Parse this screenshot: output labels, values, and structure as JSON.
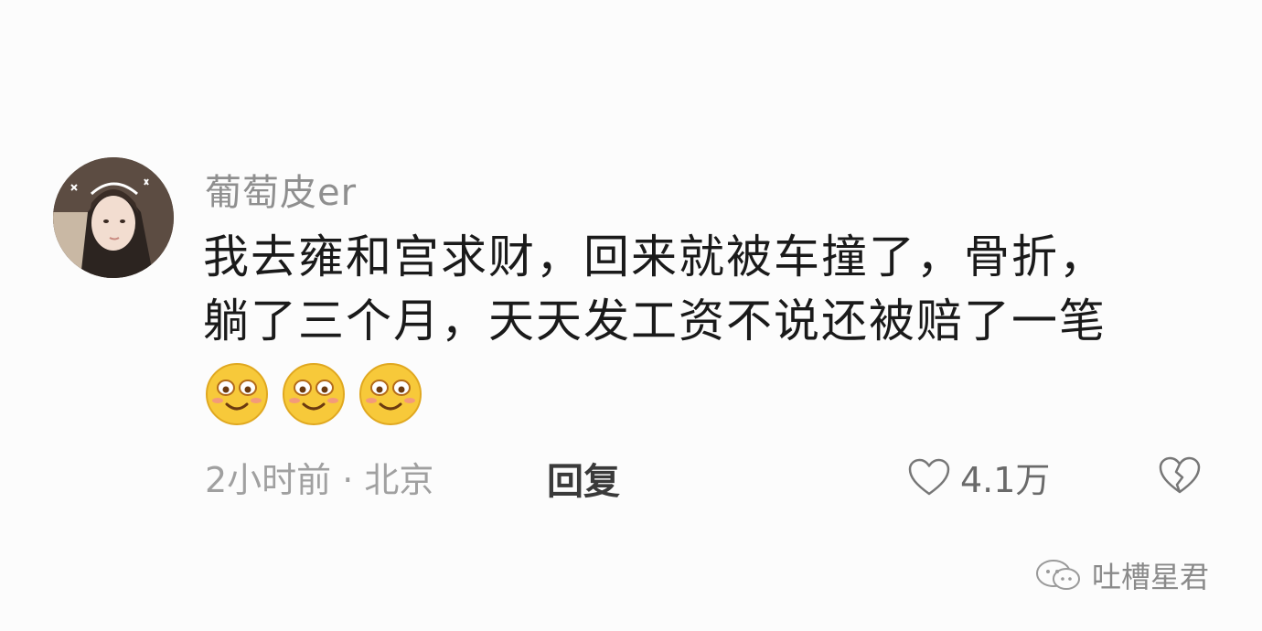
{
  "comment": {
    "username": "葡萄皮er",
    "lines": [
      "我去雍和宫求财，回来就被车撞了，骨折，",
      "躺了三个月，天天发工资不说还被赔了一笔"
    ],
    "emoji_count": 3,
    "timestamp": "2小时前 · 北京",
    "reply_label": "回复",
    "like_count": "4.1万"
  },
  "watermark": {
    "text": "吐槽星君"
  },
  "colors": {
    "background": "#fcfcfc",
    "username": "#8f8f8f",
    "text": "#1a1a1a",
    "meta": "#a0a0a0",
    "emoji_face": "#f7c93a"
  }
}
